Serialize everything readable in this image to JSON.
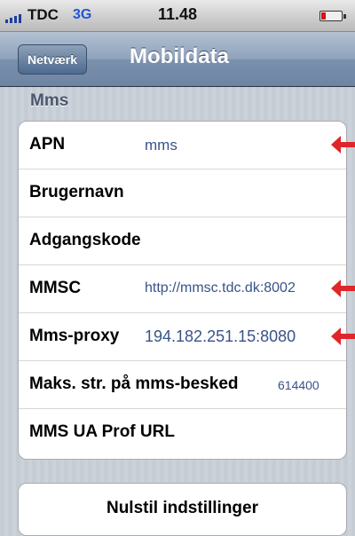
{
  "status_bar": {
    "carrier": "TDC",
    "network": "3G",
    "time": "11.48",
    "icons": [
      "signal-icon",
      "battery-icon"
    ],
    "network_color": "#2255d6"
  },
  "nav": {
    "back_label": "Netværk",
    "title": "Mobildata"
  },
  "section": {
    "header": "Mms",
    "rows": [
      {
        "label": "APN",
        "value": "mms",
        "marked": true
      },
      {
        "label": "Brugernavn",
        "value": "",
        "marked": false
      },
      {
        "label": "Adgangskode",
        "value": "",
        "marked": false
      },
      {
        "label": "MMSC",
        "value": "http://mmsc.tdc.dk:8002",
        "marked": true
      },
      {
        "label": "Mms-proxy",
        "value": "194.182.251.15:8080",
        "marked": true
      },
      {
        "label": "Maks. str. på mms-besked",
        "value": "614400",
        "marked": false
      },
      {
        "label": "MMS UA Prof URL",
        "value": "",
        "marked": false
      }
    ]
  },
  "annotation_color": "#e0262a",
  "reset_button": "Nulstil indstillinger"
}
